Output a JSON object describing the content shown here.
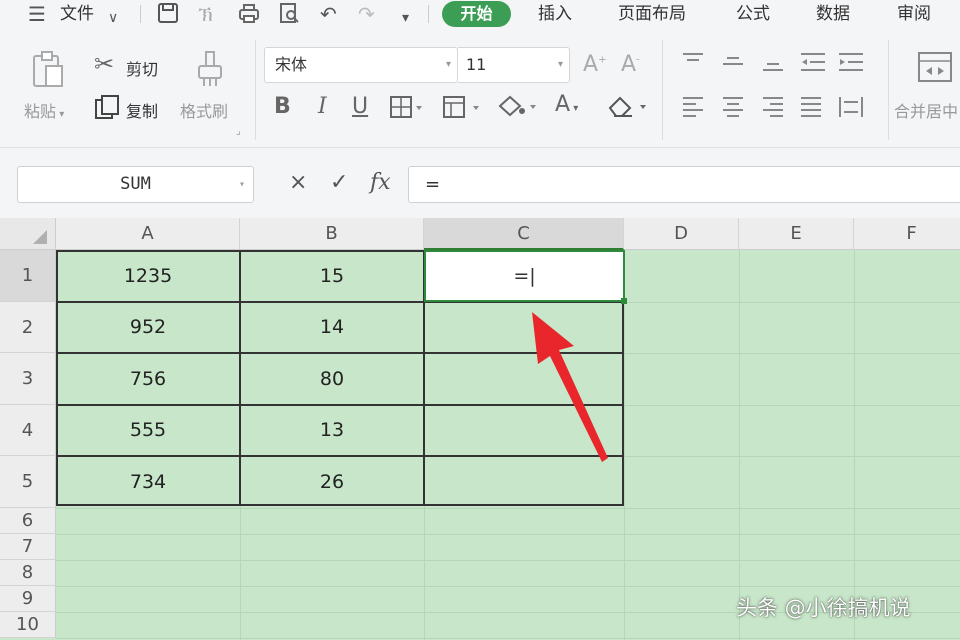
{
  "menubar": {
    "menu_icon": "hamburger-icon",
    "file_label": "文件",
    "tabs": [
      {
        "label": "开始"
      },
      {
        "label": "插入"
      },
      {
        "label": "页面布局"
      },
      {
        "label": "公式"
      },
      {
        "label": "数据"
      },
      {
        "label": "审阅"
      }
    ]
  },
  "ribbon": {
    "paste_label": "粘贴",
    "cut_label": "剪切",
    "copy_label": "复制",
    "format_painter_label": "格式刷",
    "font_name": "宋体",
    "font_size": "11",
    "merge_label": "合并居中"
  },
  "formula_bar": {
    "name_box": "SUM",
    "cancel_icon": "×",
    "enter_icon": "✓",
    "fx_label": "fx",
    "content": "="
  },
  "sheet": {
    "columns": [
      "A",
      "B",
      "C",
      "D",
      "E",
      "F"
    ],
    "rows": [
      "1",
      "2",
      "3",
      "4",
      "5",
      "6",
      "7",
      "8",
      "9",
      "10"
    ],
    "cells": {
      "A": [
        "1235",
        "952",
        "756",
        "555",
        "734"
      ],
      "B": [
        "15",
        "14",
        "80",
        "13",
        "26"
      ]
    },
    "active_cell_value": "=|",
    "accent_color": "#3c9e55"
  },
  "watermark": "头条 @小徐搞机说"
}
